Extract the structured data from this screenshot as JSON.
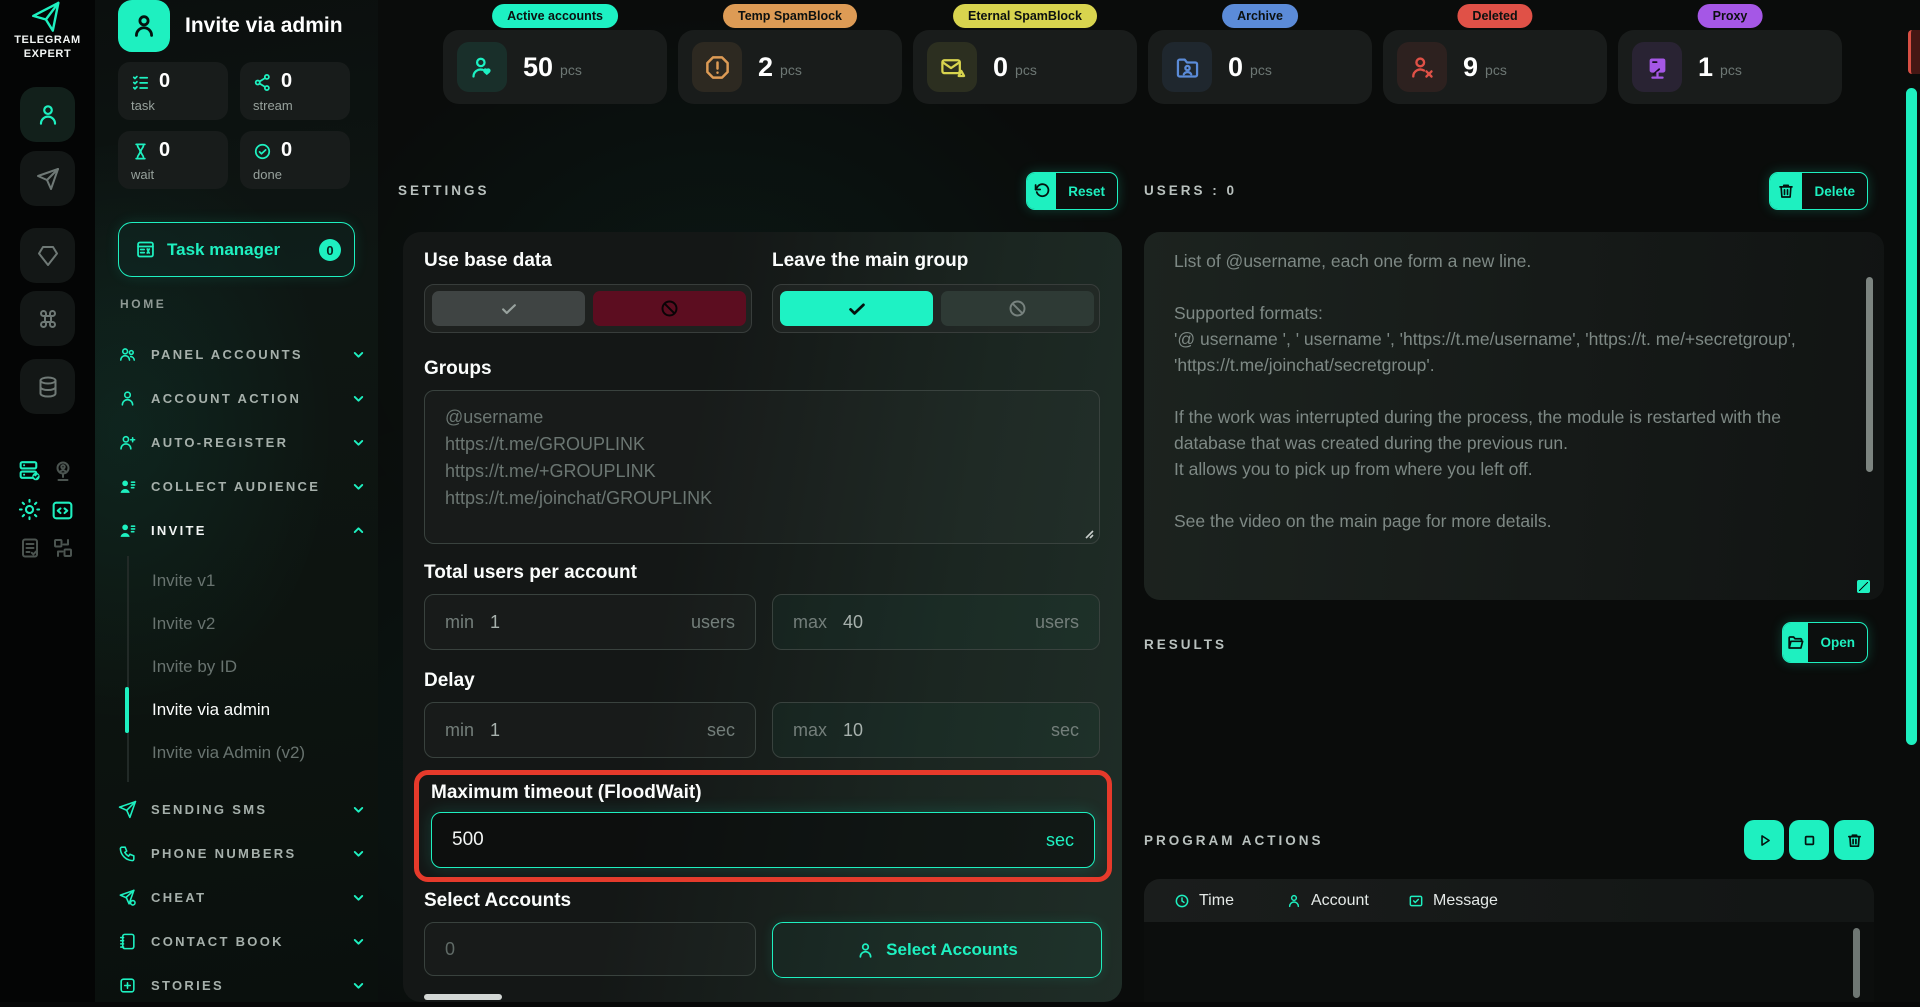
{
  "colors": {
    "accent": "#1ef0c0",
    "highlight_red": "#e63a2b",
    "toggle_no_red": "#5c0d20",
    "status": {
      "active": "#1df1c3",
      "temp_spamblock": "#dd9b55",
      "eternal_spamblock": "#d8d44e",
      "archive": "#5b8bd8",
      "deleted": "#e05147",
      "proxy": "#a557e6"
    }
  },
  "brand": {
    "l1": "TELEGRAM",
    "l2": "EXPERT"
  },
  "page": {
    "title": "Invite via admin",
    "counters": [
      {
        "v": "0",
        "l": "task"
      },
      {
        "v": "0",
        "l": "stream"
      },
      {
        "v": "0",
        "l": "wait"
      },
      {
        "v": "0",
        "l": "done"
      }
    ],
    "task_manager": {
      "label": "Task manager",
      "badge": "0"
    }
  },
  "nav": {
    "home": "HOME",
    "items": [
      {
        "label": "PANEL ACCOUNTS"
      },
      {
        "label": "ACCOUNT ACTION"
      },
      {
        "label": "AUTO-REGISTER"
      },
      {
        "label": "COLLECT AUDIENCE"
      },
      {
        "label": "INVITE"
      }
    ],
    "invite_children": [
      {
        "label": "Invite v1"
      },
      {
        "label": "Invite v2"
      },
      {
        "label": "Invite by ID"
      },
      {
        "label": "Invite via admin"
      },
      {
        "label": "Invite via Admin (v2)"
      }
    ],
    "items2": [
      {
        "label": "SENDING SMS"
      },
      {
        "label": "PHONE NUMBERS"
      },
      {
        "label": "CHEAT"
      },
      {
        "label": "CONTACT BOOK"
      },
      {
        "label": "STORIES"
      }
    ]
  },
  "stats": [
    {
      "badge": "Active accounts",
      "value": "50",
      "unit": "pcs",
      "color": "#1df1c3"
    },
    {
      "badge": "Temp SpamBlock",
      "value": "2",
      "unit": "pcs",
      "color": "#dd9b55"
    },
    {
      "badge": "Eternal SpamBlock",
      "value": "0",
      "unit": "pcs",
      "color": "#d8d44e"
    },
    {
      "badge": "Archive",
      "value": "0",
      "unit": "pcs",
      "color": "#5b8bd8"
    },
    {
      "badge": "Deleted",
      "value": "9",
      "unit": "pcs",
      "color": "#e05147"
    },
    {
      "badge": "Proxy",
      "value": "1",
      "unit": "pcs",
      "color": "#a557e6"
    }
  ],
  "settings": {
    "title": "SETTINGS",
    "reset_label": "Reset",
    "use_base_data_label": "Use base data",
    "leave_main_group_label": "Leave the main group",
    "groups_label": "Groups",
    "groups_placeholder": [
      "@username",
      "https://t.me/GROUPLINK",
      "https://t.me/+GROUPLINK",
      "https://t.me/joinchat/GROUPLINK"
    ],
    "total_users_label": "Total users per account",
    "min_label": "min",
    "max_label": "max",
    "total_users_min": "1",
    "total_users_max": "40",
    "users_unit": "users",
    "delay_label": "Delay",
    "delay_min": "1",
    "delay_max": "10",
    "sec_unit": "sec",
    "floodwait_label": "Maximum timeout (FloodWait)",
    "floodwait_value": "500",
    "floodwait_unit": "sec",
    "select_accounts_label": "Select Accounts",
    "select_accounts_placeholder": "0",
    "select_accounts_button": "Select Accounts"
  },
  "users_panel": {
    "title": "USERS : 0",
    "delete_label": "Delete",
    "placeholder": [
      "List of @username, each one form a new line.",
      "",
      "Supported formats:",
      "'@ username ', ' username ', 'https://t.me/username', 'https://t. me/+secretgroup', 'https://t.me/joinchat/secretgroup'.",
      "",
      "If the work was interrupted during the process, the module is restarted with the database that was created during the previous run.",
      "It allows you to pick up from where you left off.",
      "",
      "See the video on the main page for more details."
    ]
  },
  "results": {
    "title": "RESULTS",
    "open_label": "Open"
  },
  "program_actions": {
    "title": "PROGRAM ACTIONS",
    "columns": [
      {
        "label": "Time"
      },
      {
        "label": "Account"
      },
      {
        "label": "Message"
      }
    ]
  }
}
